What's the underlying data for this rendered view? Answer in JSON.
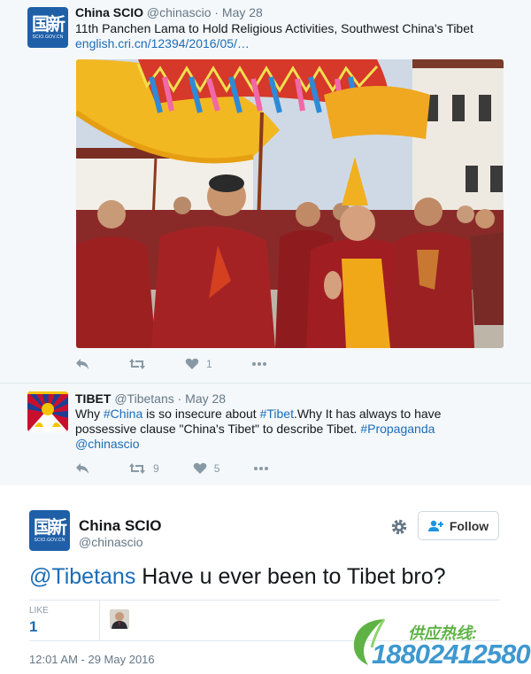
{
  "thread": {
    "tweet1": {
      "avatar_glyph": "国新",
      "avatar_sub": "SCIO.GOV.CN",
      "name": "China SCIO",
      "handle": "@chinascio",
      "date": "· May 28",
      "text": "11th Panchen Lama to Hold Religious Activities, Southwest China's Tibet",
      "link": "english.cri.cn/12394/2016/05/…",
      "photo_icon": "ceremony-photo",
      "likes": "1"
    },
    "tweet2": {
      "name": "TIBET",
      "handle": "@Tibetans",
      "date": "· May 28",
      "text_parts": {
        "p1": "Why ",
        "h1": "#China",
        "p2": " is so insecure about ",
        "h2": "#Tibet",
        "p3": ".Why It has always to have possessive clause \"China's Tibet\" to describe Tibet. ",
        "h3": "#Propaganda",
        "mention": "@chinascio"
      },
      "retweets": "9",
      "likes": "5"
    }
  },
  "main": {
    "avatar_glyph": "国新",
    "avatar_sub": "SCIO.GOV.CN",
    "name": "China SCIO",
    "handle": "@chinascio",
    "follow_label": "Follow",
    "text_mention": "@Tibetans",
    "text_body": " Have u ever been to Tibet bro?",
    "likes_label": "LIKE",
    "likes_count": "1",
    "timestamp": "12:01 AM - 29 May 2016"
  },
  "watermark": {
    "label": "供应热线:",
    "phone": "18802412580"
  },
  "colors": {
    "link": "#1b6cb7",
    "muted": "#657786",
    "icon": "#8899a6"
  }
}
